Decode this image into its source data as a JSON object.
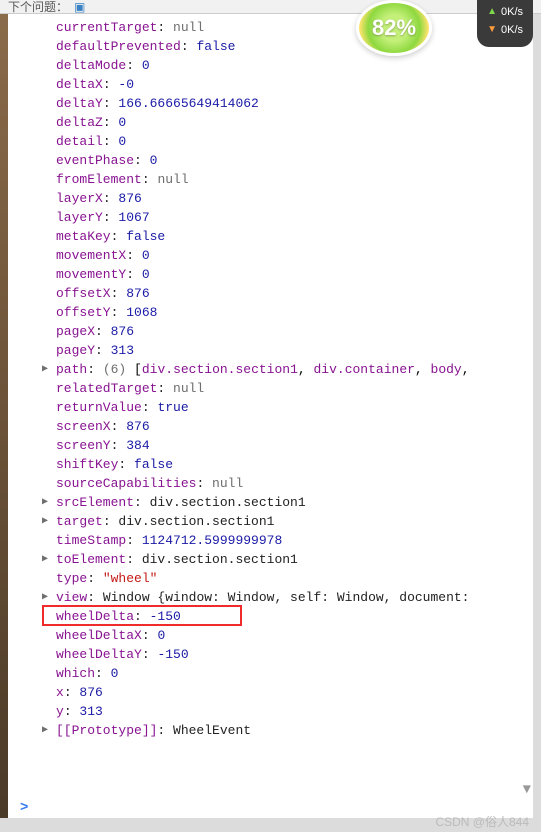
{
  "toolbar": {
    "label": "下个问题：",
    "icon": "▣"
  },
  "overlay": {
    "percent": "82%",
    "up_speed": "0K/s",
    "down_speed": "0K/s"
  },
  "props": [
    {
      "key": "currentTarget",
      "sep": ": ",
      "val": "null",
      "cls": "val-null"
    },
    {
      "key": "defaultPrevented",
      "sep": ": ",
      "val": "false",
      "cls": "val-bool"
    },
    {
      "key": "deltaMode",
      "sep": ": ",
      "val": "0",
      "cls": "val-num"
    },
    {
      "key": "deltaX",
      "sep": ": ",
      "val": "-0",
      "cls": "val-num"
    },
    {
      "key": "deltaY",
      "sep": ": ",
      "val": "166.66665649414062",
      "cls": "val-num"
    },
    {
      "key": "deltaZ",
      "sep": ": ",
      "val": "0",
      "cls": "val-num"
    },
    {
      "key": "detail",
      "sep": ": ",
      "val": "0",
      "cls": "val-num"
    },
    {
      "key": "eventPhase",
      "sep": ": ",
      "val": "0",
      "cls": "val-num"
    },
    {
      "key": "fromElement",
      "sep": ": ",
      "val": "null",
      "cls": "val-null"
    },
    {
      "key": "layerX",
      "sep": ": ",
      "val": "876",
      "cls": "val-num"
    },
    {
      "key": "layerY",
      "sep": ": ",
      "val": "1067",
      "cls": "val-num"
    },
    {
      "key": "metaKey",
      "sep": ": ",
      "val": "false",
      "cls": "val-bool"
    },
    {
      "key": "movementX",
      "sep": ": ",
      "val": "0",
      "cls": "val-num"
    },
    {
      "key": "movementY",
      "sep": ": ",
      "val": "0",
      "cls": "val-num"
    },
    {
      "key": "offsetX",
      "sep": ": ",
      "val": "876",
      "cls": "val-num"
    },
    {
      "key": "offsetY",
      "sep": ": ",
      "val": "1068",
      "cls": "val-num"
    },
    {
      "key": "pageX",
      "sep": ": ",
      "val": "876",
      "cls": "val-num"
    },
    {
      "key": "pageY",
      "sep": ": ",
      "val": "313",
      "cls": "val-num"
    },
    {
      "key": "path",
      "sep": ": ",
      "count": "(6)",
      "arr": [
        "div.section.section1",
        "div.container",
        "body"
      ],
      "expandable": true
    },
    {
      "key": "relatedTarget",
      "sep": ": ",
      "val": "null",
      "cls": "val-null"
    },
    {
      "key": "returnValue",
      "sep": ": ",
      "val": "true",
      "cls": "val-bool"
    },
    {
      "key": "screenX",
      "sep": ": ",
      "val": "876",
      "cls": "val-num"
    },
    {
      "key": "screenY",
      "sep": ": ",
      "val": "384",
      "cls": "val-num"
    },
    {
      "key": "shiftKey",
      "sep": ": ",
      "val": "false",
      "cls": "val-bool"
    },
    {
      "key": "sourceCapabilities",
      "sep": ": ",
      "val": "null",
      "cls": "val-null"
    },
    {
      "key": "srcElement",
      "sep": ": ",
      "val": "div.section.section1",
      "cls": "val-obj",
      "expandable": true
    },
    {
      "key": "target",
      "sep": ": ",
      "val": "div.section.section1",
      "cls": "val-obj",
      "expandable": true
    },
    {
      "key": "timeStamp",
      "sep": ": ",
      "val": "1124712.5999999978",
      "cls": "val-num"
    },
    {
      "key": "toElement",
      "sep": ": ",
      "val": "div.section.section1",
      "cls": "val-obj",
      "expandable": true
    },
    {
      "key": "type",
      "sep": ": ",
      "val": "\"wheel\"",
      "cls": "val-str"
    },
    {
      "key": "view",
      "sep": ": ",
      "obj_preview": "Window {window: Window, self: Window, document:",
      "expandable": true
    },
    {
      "key": "wheelDelta",
      "sep": ": ",
      "val": "-150",
      "cls": "val-num",
      "highlight": true
    },
    {
      "key": "wheelDeltaX",
      "sep": ": ",
      "val": "0",
      "cls": "val-num"
    },
    {
      "key": "wheelDeltaY",
      "sep": ": ",
      "val": "-150",
      "cls": "val-num"
    },
    {
      "key": "which",
      "sep": ": ",
      "val": "0",
      "cls": "val-num"
    },
    {
      "key": "x",
      "sep": ": ",
      "val": "876",
      "cls": "val-num"
    },
    {
      "key": "y",
      "sep": ": ",
      "val": "313",
      "cls": "val-num"
    },
    {
      "key": "[[Prototype]]",
      "sep": ": ",
      "val": "WheelEvent",
      "cls": "val-obj",
      "expandable": true
    }
  ],
  "prompt": ">",
  "watermark": "CSDN @俗人844",
  "chevron": "▼"
}
